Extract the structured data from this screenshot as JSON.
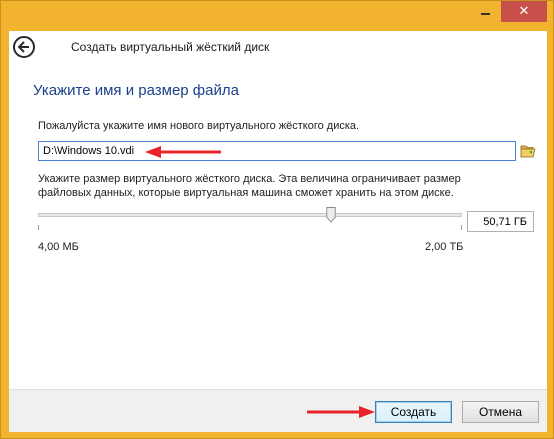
{
  "window": {
    "minimize_glyph": "",
    "close_glyph": "✕"
  },
  "header": {
    "title": "Создать виртуальный жёсткий диск",
    "back_icon": "back-arrow-circle-icon"
  },
  "main": {
    "section_title": "Укажите имя и размер файла",
    "name_prompt": "Пожалуйста укажите имя нового виртуального жёсткого диска.",
    "file_name_value": "D:\\Windows 10.vdi",
    "folder_icon": "folder-open-icon",
    "size_prompt": "Укажите размер виртуального жёсткого диска. Эта величина ограничивает размер файловых данных, которые виртуальная машина сможет хранить на этом диске.",
    "size_value": "50,71 ГБ",
    "slider_level": 0.695,
    "min_label": "4,00 МБ",
    "max_label": "2,00 ТБ"
  },
  "footer": {
    "create_label": "Создать",
    "cancel_label": "Отмена"
  },
  "colors": {
    "window_frame": "#f2b42f",
    "close_button": "#c7504b",
    "section_title": "#1b3f8b",
    "annotation_arrow": "#e8232a"
  }
}
